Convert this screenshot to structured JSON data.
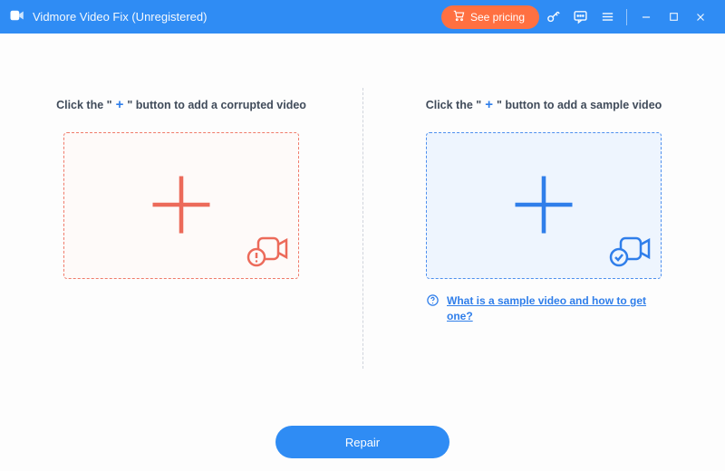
{
  "titlebar": {
    "app_title": "Vidmore Video Fix (Unregistered)",
    "see_pricing_label": "See pricing"
  },
  "corrupted_pane": {
    "instruction_pre": "Click the \"",
    "instruction_plus": "+",
    "instruction_post": "\" button to add a corrupted video"
  },
  "sample_pane": {
    "instruction_pre": "Click the \"",
    "instruction_plus": "+",
    "instruction_post": "\" button to add a sample video",
    "help_link": "What is a sample video and how to get one?"
  },
  "footer": {
    "repair_label": "Repair"
  },
  "colors": {
    "brand_blue": "#2f8cf4",
    "accent_orange": "#ff7041",
    "corrupted_red": "#ec6a5a"
  }
}
